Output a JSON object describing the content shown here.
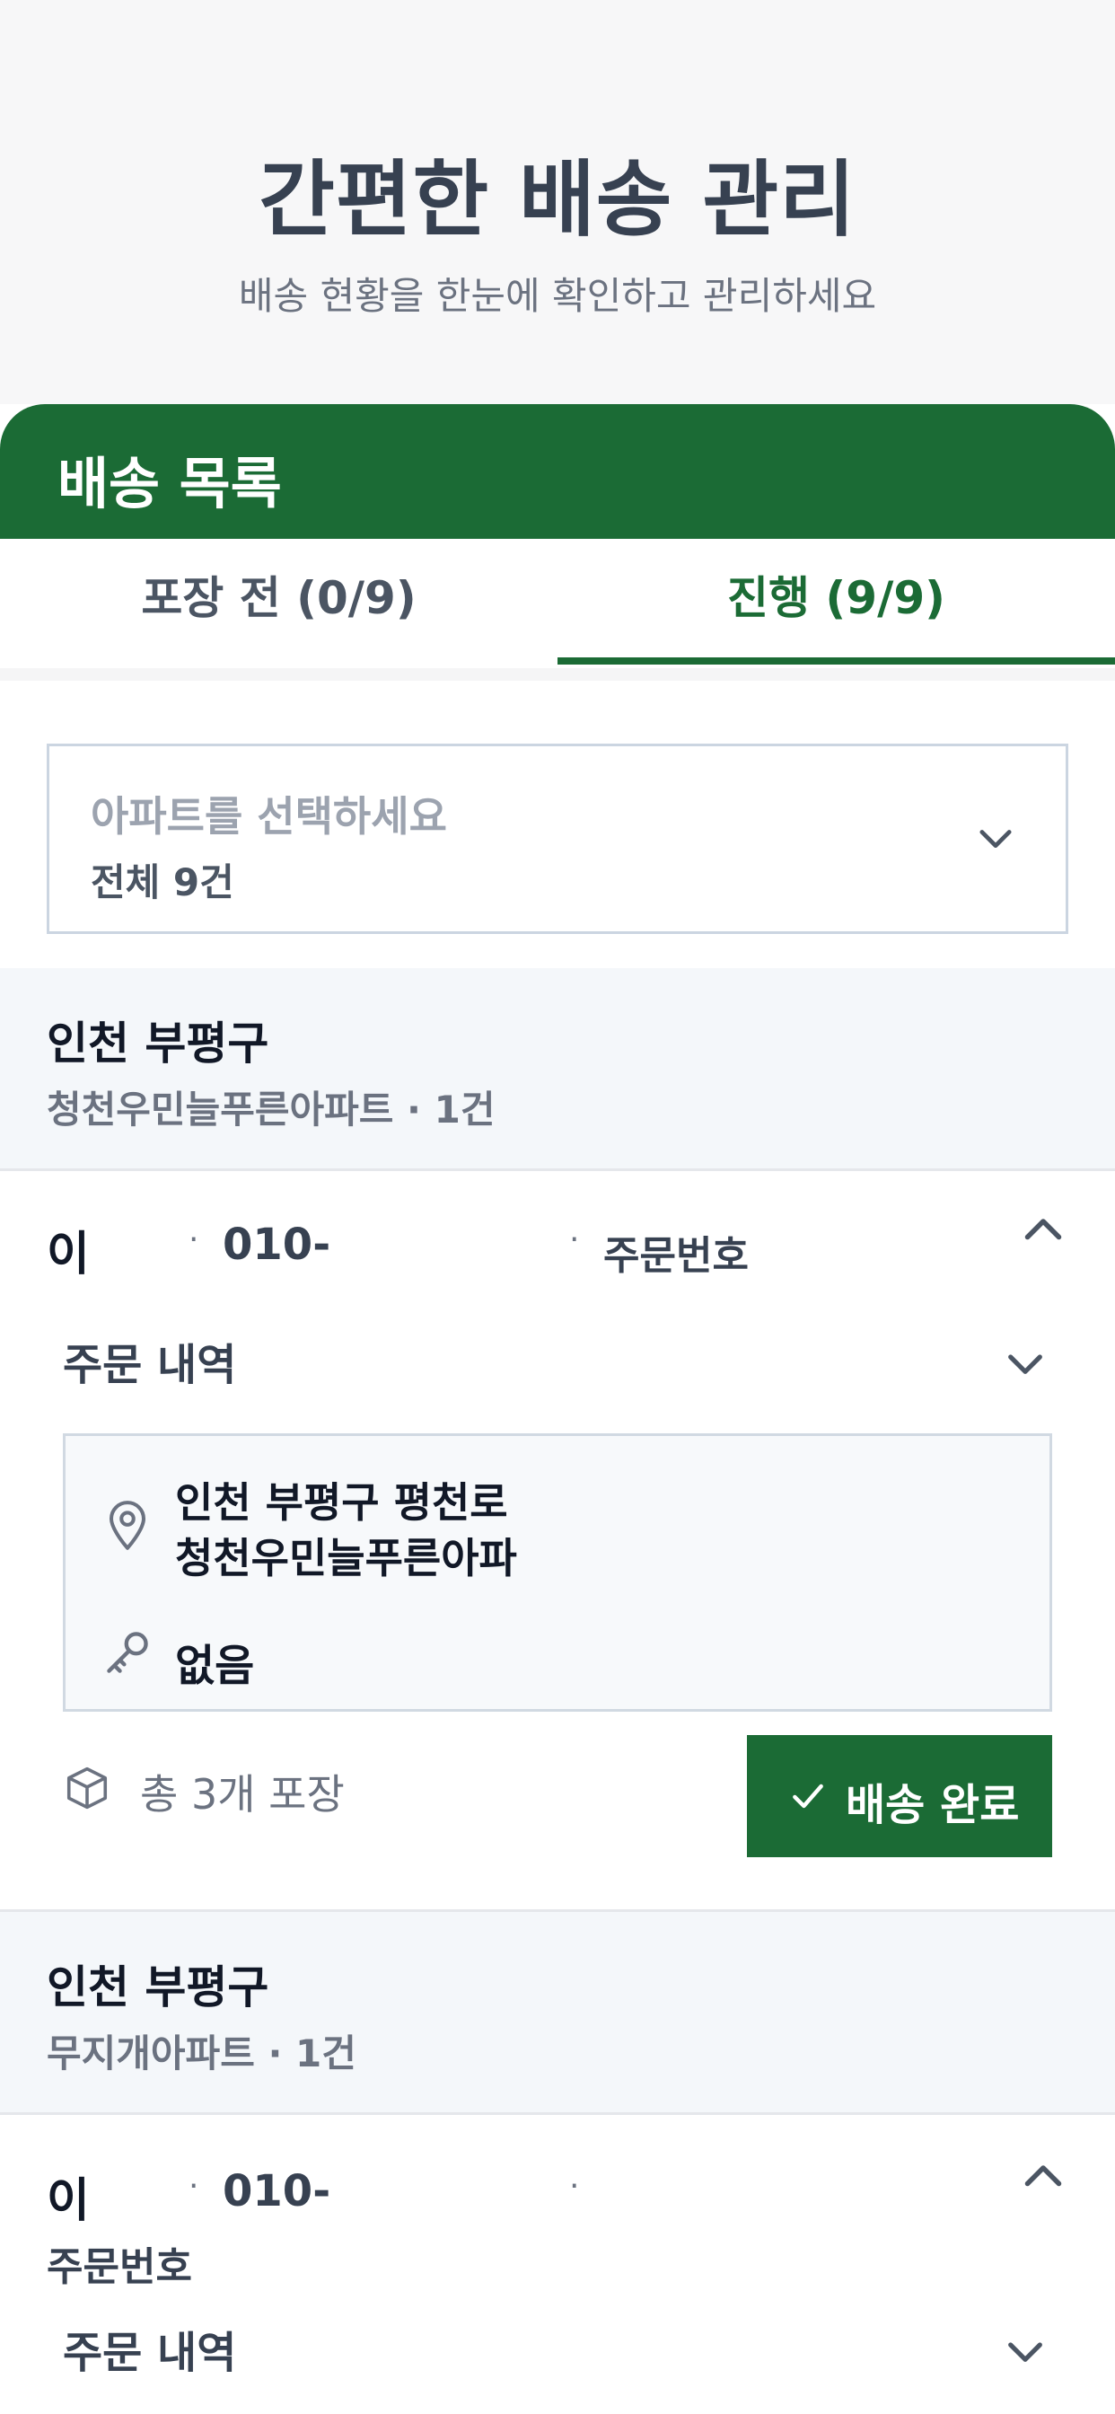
{
  "hero": {
    "title": "간편한 배송 관리",
    "subtitle": "배송 현황을 한눈에 확인하고 관리하세요"
  },
  "panel": {
    "title": "배송 목록",
    "tabs": [
      {
        "label": "포장 전 (0/9)",
        "active": false
      },
      {
        "label": "진행 (9/9)",
        "active": true
      }
    ]
  },
  "apartment_select": {
    "placeholder": "아파트를 선택하세요",
    "value": "전체 9건"
  },
  "groups": [
    {
      "region": "인천 부평구",
      "apartment": "청천우민늘푸른아파트 · 1건",
      "order": {
        "name": "이",
        "phone": "010-",
        "order_no_label": "주문번호",
        "items_label": "주문 내역",
        "address_line1": "인천 부평구 평천로",
        "address_line2": "청천우민늘푸른아파",
        "access_info": "없음",
        "package_count": "총 3개 포장",
        "complete_label": "배송 완료"
      }
    },
    {
      "region": "인천 부평구",
      "apartment": "무지개아파트 · 1건",
      "order": {
        "name": "이",
        "phone": "010-",
        "order_no_label": "주문번호",
        "items_label": "주문 내역"
      }
    }
  ],
  "separator": "·",
  "colors": {
    "brand_green": "#1b6b35",
    "background": "#f7f7f8",
    "group_header_bg": "#f4f7fa"
  },
  "icons": {
    "dropdown": "chevron-down-icon",
    "collapse": "chevron-up-icon",
    "location": "map-pin-icon",
    "access": "key-icon",
    "package": "box-icon",
    "confirm": "check-icon"
  }
}
